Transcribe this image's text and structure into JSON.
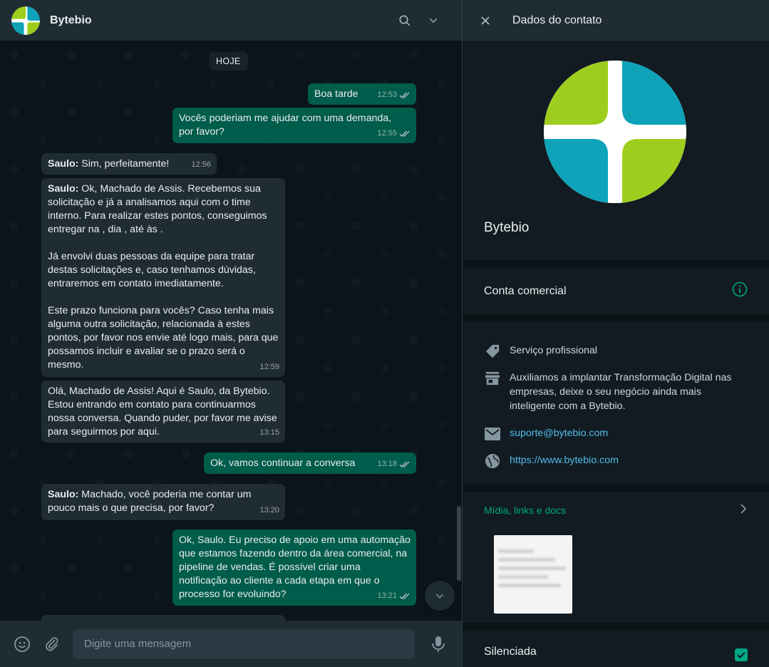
{
  "chat": {
    "title": "Bytebio",
    "date_chip": "HOJE",
    "composer_placeholder": "Digite uma mensagem"
  },
  "messages": [
    {
      "dir": "out",
      "text": "Boa tarde",
      "time": "12:53"
    },
    {
      "dir": "out",
      "text": "Vocês poderiam me ajudar com uma demanda, por favor?",
      "time": "12:55"
    },
    {
      "dir": "in",
      "sender": "Saulo:",
      "text": " Sim, perfeitamente!",
      "time": "12:56"
    },
    {
      "dir": "in",
      "sender": "Saulo:",
      "text": " Ok, Machado de Assis. Recebemos sua solicitação e já a analisamos aqui com o time interno. Para realizar estes pontos, conseguimos entregar na , dia , até às .\n\nJá envolvi duas pessoas da equipe para tratar destas solicitações e, caso tenhamos dúvidas, entraremos em contato imediatamente.\n\nEste prazo funciona para vocês? Caso tenha mais alguma outra solicitação, relacionada à estes pontos, por favor nos envie até logo mais, para que possamos incluir e avaliar se o prazo será o mesmo.",
      "time": "12:59"
    },
    {
      "dir": "in",
      "sender": "",
      "text": "Olá, Machado de Assis! Aqui é Saulo, da Bytebio. Estou entrando em contato para continuarmos nossa conversa. Quando puder, por favor me avise para seguirmos por aqui.",
      "time": "13:15"
    },
    {
      "dir": "out",
      "text": "Ok, vamos continuar a conversa",
      "time": "13:18"
    },
    {
      "dir": "in",
      "sender": "Saulo:",
      "text": " Machado, você poderia me contar um pouco mais o que precisa, por favor?",
      "time": "13:20"
    },
    {
      "dir": "out",
      "text": "Ok, Saulo. Eu preciso de apoio em uma automação que estamos fazendo dentro da área comercial, na pipeline de vendas. É possível criar uma notificação ao cliente a cada etapa em que o processo for evoluindo?",
      "time": "13:21"
    }
  ],
  "contact": {
    "header_title": "Dados do contato",
    "name": "Bytebio",
    "business_label": "Conta comercial",
    "category": "Serviço profissional",
    "description": "Auxiliamos a implantar Transformação Digital nas empresas, deixe o seu negócio ainda mais inteligente com a Bytebio.",
    "email": "suporte@bytebio.com",
    "website": "https://www.bytebio.com",
    "media_title": "Mídia, links e docs",
    "muted_label": "Silenciada"
  },
  "colors": {
    "accent": "#00a884",
    "outgoing": "#005c4b",
    "incoming": "#202c33",
    "logo_green": "#9dce1d",
    "logo_teal": "#0ea3b8"
  }
}
